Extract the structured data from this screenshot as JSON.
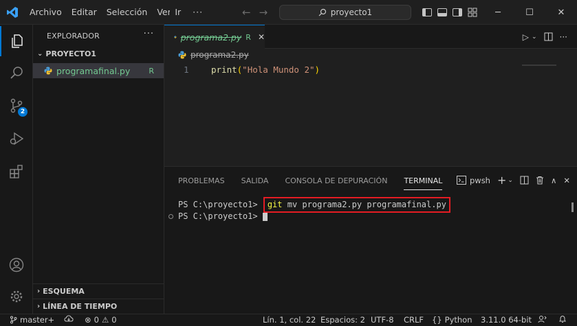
{
  "titlebar": {
    "menu": [
      "Archivo",
      "Editar",
      "Selección",
      "Ver",
      "Ir"
    ],
    "more": "···",
    "search": "proyecto1"
  },
  "activity": {
    "scm_badge": "2"
  },
  "sidebar": {
    "header": "EXPLORADOR",
    "more": "···",
    "project": "PROYECTO1",
    "file": {
      "name": "programafinal.py",
      "status": "R"
    },
    "sections": [
      "ESQUEMA",
      "LÍNEA DE TIEMPO"
    ]
  },
  "editor": {
    "tab": {
      "name": "programa2.py",
      "status": "R"
    },
    "breadcrumb": "programa2.py",
    "line_number": "1",
    "code": {
      "fn": "print",
      "open": "(",
      "str": "\"Hola Mundo 2\"",
      "close": ")"
    }
  },
  "panel": {
    "tabs": [
      "PROBLEMAS",
      "SALIDA",
      "CONSOLA DE DEPURACIÓN",
      "TERMINAL"
    ],
    "shell": "pwsh",
    "prompt": "PS C:\\proyecto1> ",
    "cmd_git": "git",
    "cmd_rest": " mv programa2.py programafinal.py"
  },
  "status": {
    "branch": "master+",
    "errors": "0",
    "warnings": "0",
    "position": "Lín. 1, col. 22",
    "spaces": "Espacios: 2",
    "encoding": "UTF-8",
    "eol": "CRLF",
    "language": "Python",
    "interpreter": "3.11.0 64-bit"
  }
}
